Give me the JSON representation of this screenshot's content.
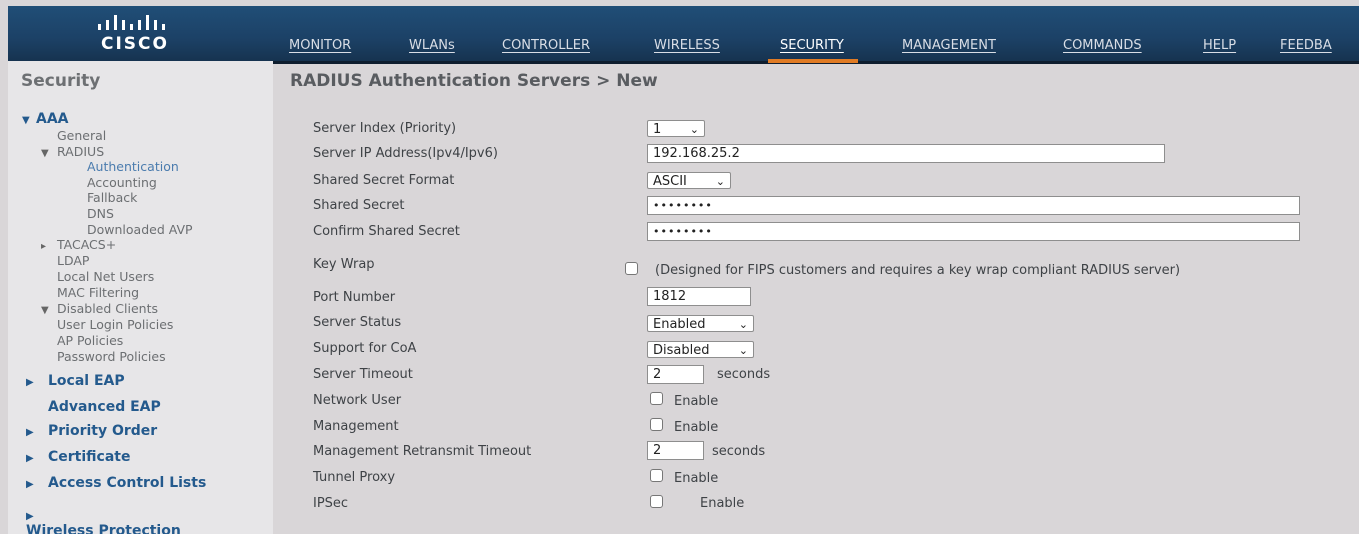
{
  "header": {
    "logo_text": "CISCO",
    "nav": [
      {
        "label": "MONITOR",
        "active": false
      },
      {
        "label": "WLANs",
        "active": false
      },
      {
        "label": "CONTROLLER",
        "active": false
      },
      {
        "label": "WIRELESS",
        "active": false
      },
      {
        "label": "SECURITY",
        "active": true
      },
      {
        "label": "MANAGEMENT",
        "active": false
      },
      {
        "label": "COMMANDS",
        "active": false
      },
      {
        "label": "HELP",
        "active": false
      },
      {
        "label": "FEEDBA",
        "active": false
      }
    ]
  },
  "sidebar": {
    "title": "Security",
    "aaa": "AAA",
    "general": "General",
    "radius": "RADIUS",
    "authentication": "Authentication",
    "accounting": "Accounting",
    "fallback": "Fallback",
    "dns": "DNS",
    "downloaded_avp": "Downloaded AVP",
    "tacacs": "TACACS+",
    "ldap": "LDAP",
    "local_net_users": "Local Net Users",
    "mac_filtering": "MAC Filtering",
    "disabled_clients": "Disabled Clients",
    "user_login_policies": "User Login Policies",
    "ap_policies": "AP Policies",
    "password_policies": "Password Policies",
    "local_eap": "Local EAP",
    "advanced_eap": "Advanced EAP",
    "priority_order": "Priority Order",
    "certificate": "Certificate",
    "acl": "Access Control Lists",
    "wireless_protection": "Wireless Protection Policies"
  },
  "page": {
    "title": "RADIUS Authentication Servers > New"
  },
  "form": {
    "server_index_label": "Server Index (Priority)",
    "server_index_value": "1",
    "server_ip_label": "Server IP Address(Ipv4/Ipv6)",
    "server_ip_value": "192.168.25.2",
    "secret_format_label": "Shared Secret Format",
    "secret_format_value": "ASCII",
    "shared_secret_label": "Shared Secret",
    "shared_secret_value": "••••••••",
    "confirm_secret_label": "Confirm Shared Secret",
    "confirm_secret_value": "••••••••",
    "key_wrap_label": "Key Wrap",
    "key_wrap_note": "(Designed for FIPS customers and requires a key wrap compliant RADIUS server)",
    "port_label": "Port Number",
    "port_value": "1812",
    "server_status_label": "Server Status",
    "server_status_value": "Enabled",
    "coa_label": "Support for CoA",
    "coa_value": "Disabled",
    "timeout_label": "Server Timeout",
    "timeout_value": "2",
    "timeout_unit": "seconds",
    "network_user_label": "Network User",
    "management_label": "Management",
    "mgmt_retransmit_label": "Management Retransmit Timeout",
    "mgmt_retransmit_value": "2",
    "mgmt_retransmit_unit": "seconds",
    "tunnel_proxy_label": "Tunnel Proxy",
    "ipsec_label": "IPSec",
    "enable_text": "Enable"
  },
  "colors": {
    "header_blue": "#1c4166",
    "active_tab_orange": "#e07b24",
    "sidebar_link_blue": "#245a8d"
  }
}
